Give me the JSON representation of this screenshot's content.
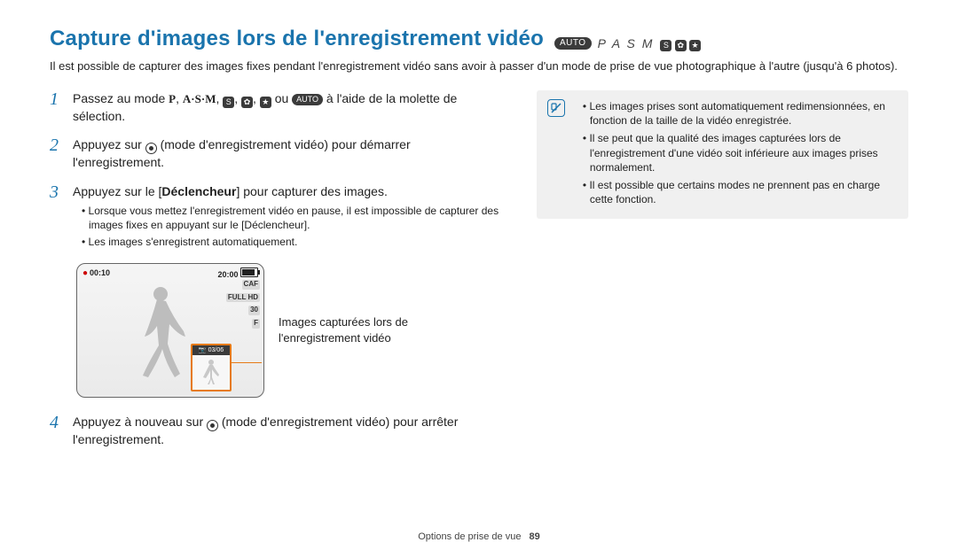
{
  "title": "Capture d'images lors de l'enregistrement vidéo",
  "mode_strip": {
    "auto": "AUTO",
    "letters": "P A S M",
    "glyphs": "ⓢ ✿ ✦"
  },
  "intro": "Il est possible de capturer des images fixes pendant l'enregistrement vidéo sans avoir à passer d'un mode de prise de vue photographique à l'autre (jusqu'à 6 photos).",
  "steps": {
    "s1": {
      "num": "1",
      "pre": "Passez au mode ",
      "modes_p": "P",
      "modes_asm": "A·S·M",
      "ou": " ou ",
      "auto": "AUTO",
      "post": " à l'aide de la molette de sélection."
    },
    "s2": {
      "num": "2",
      "pre": "Appuyez sur ",
      "post": " (mode d'enregistrement vidéo) pour démarrer l'enregistrement."
    },
    "s3": {
      "num": "3",
      "pre": "Appuyez sur le [",
      "bold": "Déclencheur",
      "post": "] pour capturer des images.",
      "bullets": [
        "Lorsque vous mettez l'enregistrement vidéo en pause, il est impossible de capturer des images fixes en appuyant sur le [Déclencheur].",
        "Les images s'enregistrent automatiquement."
      ]
    },
    "s4": {
      "num": "4",
      "pre": "Appuyez à nouveau sur ",
      "post": " (mode d'enregistrement vidéo) pour arrêter l'enregistrement."
    }
  },
  "shot": {
    "rec_time": "00:10",
    "total_time": "20:00",
    "right_icons": [
      "CAF",
      "FULL HD",
      "30",
      "F"
    ],
    "thumb_counter": "03/06"
  },
  "caption": "Images capturées lors de l'enregistrement vidéo",
  "notes": [
    "Les images prises sont automatiquement redimensionnées, en fonction de la taille de la vidéo enregistrée.",
    "Il se peut que la qualité des images capturées lors de l'enregistrement d'une vidéo soit inférieure aux images prises normalement.",
    "Il est possible que certains modes ne prennent pas en charge cette fonction."
  ],
  "footer": {
    "section": "Options de prise de vue",
    "page": "89"
  }
}
